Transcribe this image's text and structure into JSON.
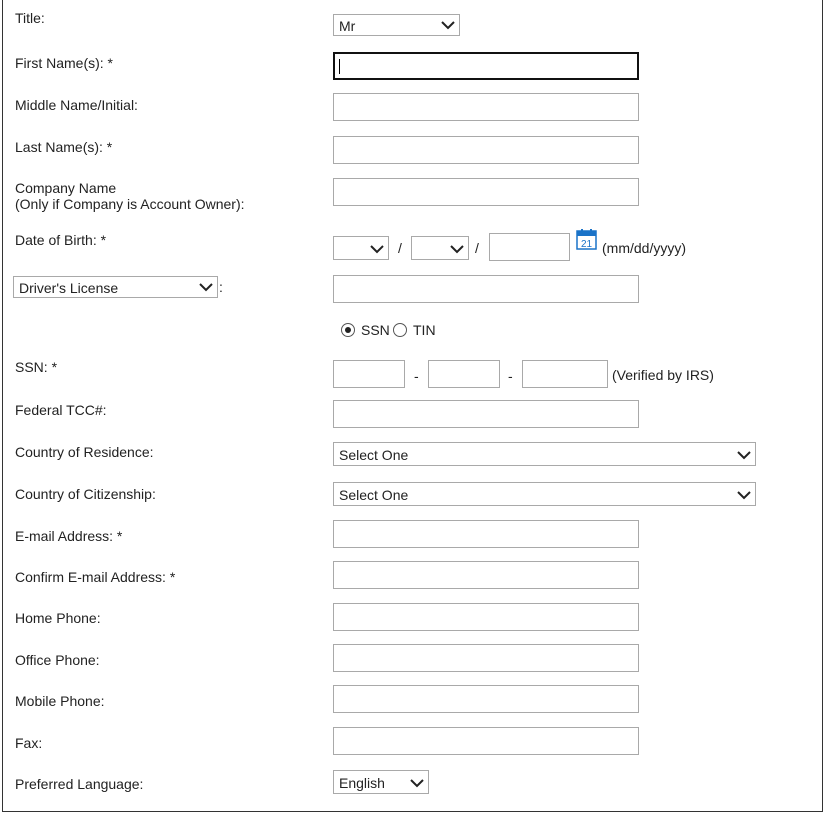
{
  "labels": {
    "title": "Title:",
    "first_name": "First Name(s): *",
    "middle_name": "Middle Name/Initial:",
    "last_name": "Last Name(s): *",
    "company_line1": "Company Name",
    "company_line2": "(Only if Company is Account Owner):",
    "dob": "Date of Birth: *",
    "id_suffix": ":",
    "ssn": "SSN: *",
    "tcc": "Federal TCC#:",
    "residence": "Country of Residence:",
    "citizenship": "Country of Citizenship:",
    "email": "E-mail Address: *",
    "confirm_email": "Confirm E-mail Address: *",
    "home_phone": "Home Phone:",
    "office_phone": "Office Phone:",
    "mobile_phone": "Mobile Phone:",
    "fax": "Fax:",
    "language": "Preferred Language:"
  },
  "fields": {
    "title_select": "Mr",
    "id_type_select": "Driver's License",
    "residence_select": "Select One",
    "citizenship_select": "Select One",
    "language_select": "English",
    "first_name": "",
    "middle_name": "",
    "last_name": "",
    "company_name": "",
    "id_number": "",
    "tcc": "",
    "email": "",
    "confirm_email": "",
    "home_phone": "",
    "office_phone": "",
    "mobile_phone": "",
    "fax": ""
  },
  "dob": {
    "separator1": "/",
    "separator2": "/",
    "format_hint": "(mm/dd/yyyy)",
    "calendar_day": "21"
  },
  "tax_id": {
    "ssn_label": "SSN",
    "tin_label": "TIN",
    "selected": "SSN",
    "dash1": "-",
    "dash2": "-",
    "verified_note": "(Verified by IRS)"
  },
  "icons": {
    "dropdown": "chevron-down-icon",
    "calendar": "calendar-icon"
  },
  "colors": {
    "calendar_accent": "#1a73c8"
  }
}
